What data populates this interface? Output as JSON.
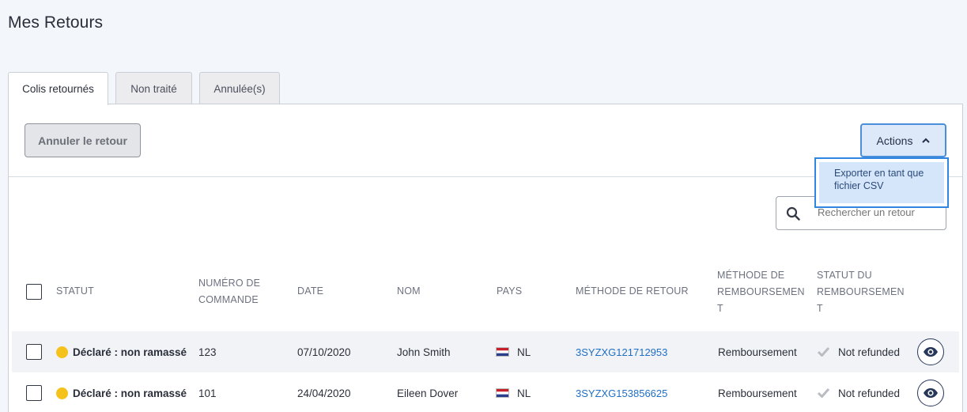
{
  "page": {
    "title": "Mes Retours"
  },
  "tabs": [
    {
      "label": "Colis retournés",
      "active": true
    },
    {
      "label": "Non traité",
      "active": false
    },
    {
      "label": "Annulée(s)",
      "active": false
    }
  ],
  "toolbar": {
    "cancel_label": "Annuler le retour",
    "actions_label": "Actions",
    "actions_menu": [
      {
        "label": "Exporter en tant que fichier CSV"
      }
    ]
  },
  "search": {
    "placeholder": "Rechercher un retour"
  },
  "table": {
    "headers": {
      "statut": "STATUT",
      "numero": [
        "NUMÉRO DE",
        "COMMANDE"
      ],
      "date": "DATE",
      "nom": "NOM",
      "pays": "PAYS",
      "methode_retour": "MÉTHODE DE RETOUR",
      "methode_remb": [
        "MÉTHODE DE",
        "REMBOURSEMEN",
        "T"
      ],
      "statut_remb": [
        "STATUT DU",
        "REMBOURSEMEN",
        "T"
      ]
    },
    "rows": [
      {
        "statut": "Déclaré : non ramassé",
        "numero": "123",
        "date": "07/10/2020",
        "nom": "John Smith",
        "pays": "NL",
        "methode_retour": "3SYZXG121712953",
        "methode_remb": "Remboursement",
        "statut_remb": "Not refunded"
      },
      {
        "statut": "Déclaré : non ramassé",
        "numero": "101",
        "date": "24/04/2020",
        "nom": "Eileen Dover",
        "pays": "NL",
        "methode_retour": "3SYZXG153856625",
        "methode_remb": "Remboursement",
        "statut_remb": "Not refunded"
      }
    ]
  },
  "colors": {
    "accent": "#4a8fd9",
    "status_pending": "#f5c21b",
    "link": "#1f6fc5"
  },
  "icons": {
    "search": "search-icon",
    "eye": "eye-icon",
    "check": "check-icon",
    "chevron": "chevron-up-icon",
    "flag": "flag-nl-icon"
  }
}
